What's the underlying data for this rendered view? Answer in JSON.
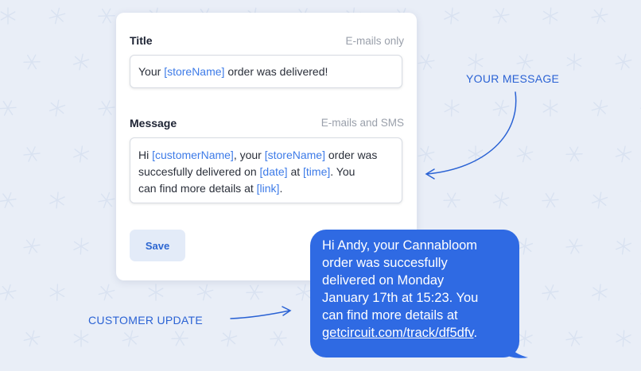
{
  "form": {
    "title_label": "Title",
    "title_hint": "E-mails only",
    "title_value": {
      "pre": "Your ",
      "var1": "[storeName]",
      "post": " order was delivered!"
    },
    "message_label": "Message",
    "message_hint": "E-mails and SMS",
    "message_value": {
      "t1": "Hi ",
      "v1": "[customerName]",
      "t2": ", your ",
      "v2": "[storeName]",
      "t3": " order was",
      "t4": "succesfully delivered on ",
      "v3": "[date]",
      "t5": " at ",
      "v4": "[time]",
      "t6": ". You",
      "t7": "can find more details at ",
      "v5": "[link]",
      "t8": "."
    },
    "save_label": "Save"
  },
  "callouts": {
    "your_message": "YOUR MESSAGE",
    "customer_update": "CUSTOMER UPDATE"
  },
  "sms_bubble": {
    "lines": [
      "Hi Andy, your Cannabloom",
      "order was succesfully",
      "delivered on Monday",
      "January 17th at 15:23. You",
      "can find more details at"
    ],
    "link": "getcircuit.com/track/df5dfv",
    "link_suffix": "."
  },
  "colors": {
    "background": "#e9eef7",
    "accent": "#2f6ae3",
    "template_var": "#3d7be8",
    "callout_text": "#2a62d4"
  }
}
